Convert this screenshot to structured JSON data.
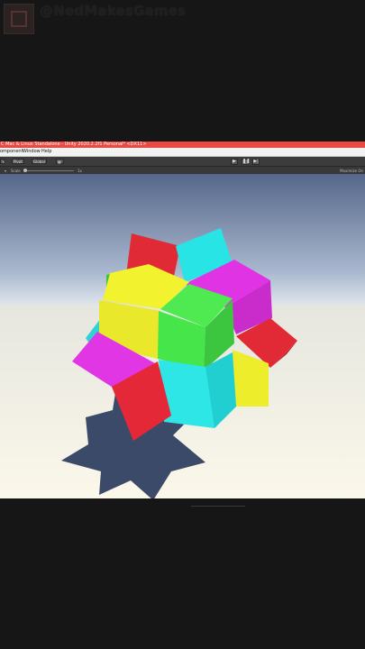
{
  "watermark": {
    "channel": "@NedMakesGames",
    "avatar_icon": "channel-avatar-icon"
  },
  "window": {
    "title": "C Mac & Linux Standalone - Unity 2020.2.2f1 Personal* <DX11>",
    "titlebar_color": "#e94a43"
  },
  "menu": {
    "items": [
      "omponent",
      "Window",
      "Help"
    ]
  },
  "toolbar": {
    "pivot_label": "Pivot",
    "global_label": "Global",
    "play_icon": "play-icon",
    "pause_icon": "pause-icon",
    "step_icon": "step-icon"
  },
  "game_view": {
    "display_label": "Scale",
    "scale_value": "1x",
    "maximize_label": "Maximize On",
    "sky_color": "#5d7090",
    "ground_color": "#f6f3e6"
  },
  "scene_colors": {
    "red": "#e22a36",
    "cyan": "#27e7e7",
    "magenta": "#e234e6",
    "yellow": "#f0f02c",
    "green": "#46e64a",
    "shadow": "#3a4a6a"
  }
}
